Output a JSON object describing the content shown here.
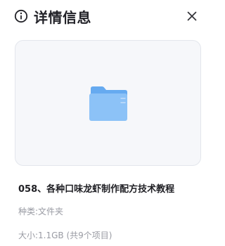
{
  "header": {
    "title": "详情信息",
    "info_icon": "info-circle-icon",
    "close_icon": "close-icon"
  },
  "preview": {
    "icon": "folder-icon",
    "colors": {
      "folder_back": "#66aaf0",
      "folder_front": "#8cc2f7",
      "background": "#f6f7fa"
    }
  },
  "file": {
    "name": "058、各种口味龙虾制作配方技术教程",
    "kind_label": "种类:",
    "kind_value": "文件夹",
    "size_label": "大小:",
    "size_value": "1.1GB (共9个项目)"
  }
}
